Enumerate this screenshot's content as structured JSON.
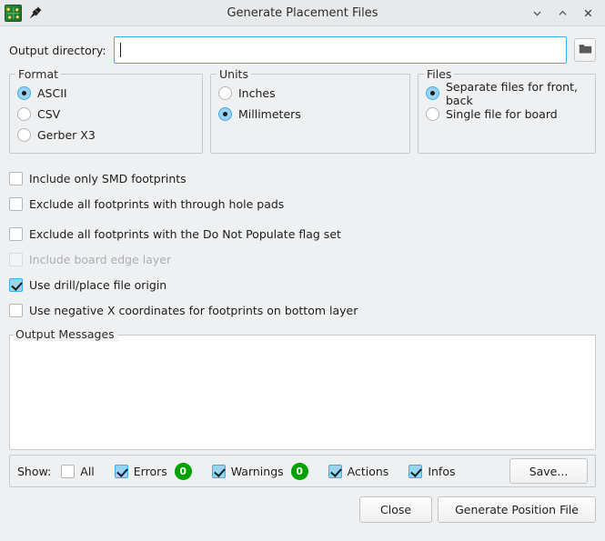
{
  "window": {
    "title": "Generate Placement Files",
    "app_icon": "kicad-pcb-icon",
    "pin_icon": "pin-icon",
    "controls": [
      {
        "name": "minimize-button",
        "icon": "chevron-down-icon"
      },
      {
        "name": "maximize-button",
        "icon": "chevron-up-icon"
      },
      {
        "name": "close-button",
        "icon": "close-icon"
      }
    ]
  },
  "output_directory": {
    "label": "Output directory:",
    "value": "",
    "placeholder": "",
    "browse_icon": "folder-icon"
  },
  "format": {
    "title": "Format",
    "options": [
      {
        "label": "ASCII",
        "selected": true
      },
      {
        "label": "CSV",
        "selected": false
      },
      {
        "label": "Gerber X3",
        "selected": false
      }
    ]
  },
  "units": {
    "title": "Units",
    "options": [
      {
        "label": "Inches",
        "selected": false
      },
      {
        "label": "Millimeters",
        "selected": true
      }
    ]
  },
  "files": {
    "title": "Files",
    "options": [
      {
        "label": "Separate files for front, back",
        "selected": true
      },
      {
        "label": "Single file for board",
        "selected": false
      }
    ]
  },
  "options": [
    {
      "label": "Include only SMD footprints",
      "checked": false,
      "disabled": false
    },
    {
      "label": "Exclude all footprints with through hole pads",
      "checked": false,
      "disabled": false
    },
    {
      "label": "Exclude all footprints with the Do Not Populate flag set",
      "checked": false,
      "disabled": false
    },
    {
      "label": "Include board edge layer",
      "checked": false,
      "disabled": true
    },
    {
      "label": "Use drill/place file origin",
      "checked": true,
      "disabled": false
    },
    {
      "label": "Use negative X coordinates for footprints on bottom layer",
      "checked": false,
      "disabled": false
    }
  ],
  "output_messages": {
    "title": "Output Messages",
    "text": ""
  },
  "status_bar": {
    "show_label": "Show:",
    "filters": [
      {
        "label": "All",
        "checked": false,
        "count": null
      },
      {
        "label": "Errors",
        "checked": true,
        "count": "0"
      },
      {
        "label": "Warnings",
        "checked": true,
        "count": "0"
      },
      {
        "label": "Actions",
        "checked": true,
        "count": null
      },
      {
        "label": "Infos",
        "checked": true,
        "count": null
      }
    ],
    "save_label": "Save..."
  },
  "footer": {
    "close_label": "Close",
    "generate_label": "Generate Position File"
  },
  "colors": {
    "accent": "#3daee9",
    "check_fill": "#9bd2f2",
    "badge_green": "#00a000",
    "window_bg": "#eff0f1"
  }
}
